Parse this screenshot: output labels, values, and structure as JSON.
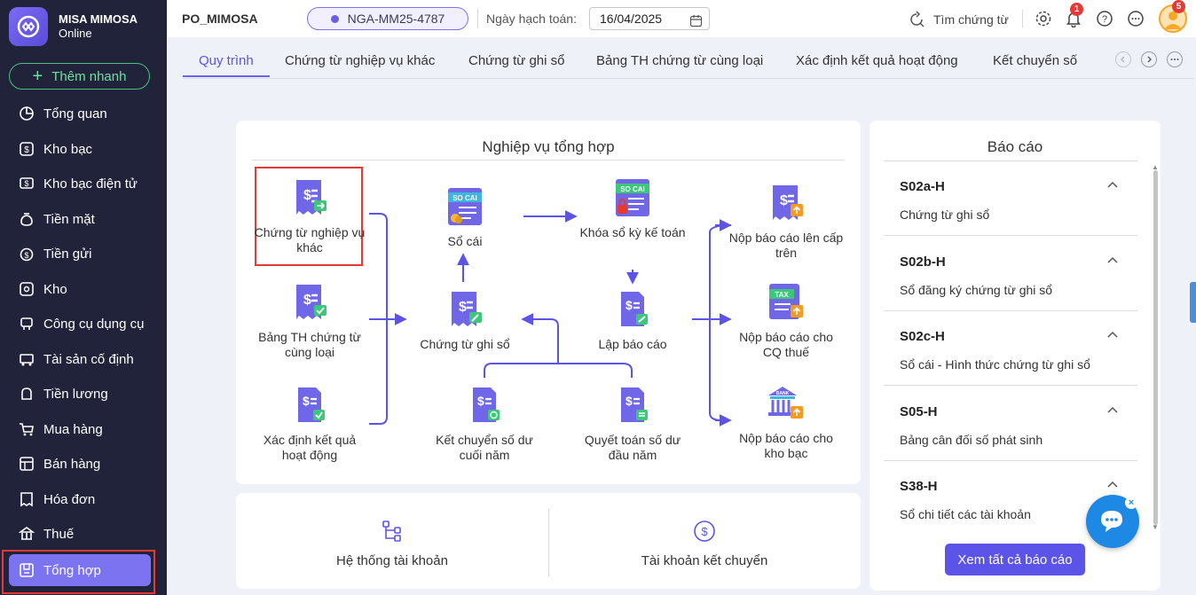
{
  "brand": {
    "name": "MISA MIMOSA",
    "sub": "Online"
  },
  "quick_add": {
    "label": "Thêm nhanh"
  },
  "sidebar": {
    "items": [
      {
        "label": "Tổng quan",
        "icon": "pie-chart-icon"
      },
      {
        "label": "Kho bạc",
        "icon": "treasury-icon"
      },
      {
        "label": "Kho bạc điện tử",
        "icon": "e-treasury-icon"
      },
      {
        "label": "Tiền mặt",
        "icon": "cash-icon"
      },
      {
        "label": "Tiền gửi",
        "icon": "deposit-icon"
      },
      {
        "label": "Kho",
        "icon": "warehouse-icon"
      },
      {
        "label": "Công cụ dụng cụ",
        "icon": "tools-icon"
      },
      {
        "label": "Tài sản cố định",
        "icon": "asset-icon"
      },
      {
        "label": "Tiền lương",
        "icon": "salary-icon"
      },
      {
        "label": "Mua hàng",
        "icon": "cart-icon"
      },
      {
        "label": "Bán hàng",
        "icon": "sales-icon"
      },
      {
        "label": "Hóa đơn",
        "icon": "invoice-icon"
      },
      {
        "label": "Thuế",
        "icon": "tax-icon"
      },
      {
        "label": "Tổng hợp",
        "icon": "summary-icon",
        "active": true
      }
    ]
  },
  "topbar": {
    "company": "PO_MIMOSA",
    "database": "NGA-MM25-4787",
    "date_label": "Ngày hạch toán:",
    "date_value": "16/04/2025",
    "search_label": "Tìm chứng từ",
    "notification_count": "1",
    "avatar_badge": "5"
  },
  "tabs": [
    {
      "label": "Quy trình",
      "active": true
    },
    {
      "label": "Chứng từ nghiệp vụ khác"
    },
    {
      "label": "Chứng từ ghi sổ"
    },
    {
      "label": "Bảng TH chứng từ cùng loại"
    },
    {
      "label": "Xác định kết quả hoạt động"
    },
    {
      "label": "Kết chuyển số"
    }
  ],
  "process": {
    "title": "Nghiệp vụ tổng hợp",
    "nodes": {
      "ct_nghiep_vu_khac": "Chứng từ nghiệp vụ khác",
      "bang_th": "Bảng TH chứng từ cùng loại",
      "xac_dinh_kq": "Xác định kết quả hoạt động",
      "so_cai": "Sổ cái",
      "ct_ghi_so": "Chứng từ ghi sổ",
      "ket_chuyen": "Kết chuyển số dư cuối năm",
      "khoa_so": "Khóa sổ kỳ kế toán",
      "lap_bao_cao": "Lập báo cáo",
      "quyet_toan": "Quyết toán số dư đầu năm",
      "nop_cap_tren": "Nộp báo cáo lên cấp trên",
      "nop_thue": "Nộp báo cáo cho CQ thuế",
      "nop_kho_bac": "Nộp báo cáo cho kho bạc"
    },
    "icon_labels": {
      "so_cai": "SO CAI",
      "tax": "TAX",
      "bank": "BANK"
    }
  },
  "bottom": {
    "he_thong_tk": "Hệ thống tài khoản",
    "tk_ket_chuyen": "Tài khoản kết chuyển"
  },
  "reports": {
    "title": "Báo cáo",
    "items": [
      {
        "code": "S02a-H",
        "name": "Chứng từ ghi sổ"
      },
      {
        "code": "S02b-H",
        "name": "Sổ đăng ký chứng từ ghi sổ"
      },
      {
        "code": "S02c-H",
        "name": "Sổ cái - Hình thức chứng từ ghi sổ"
      },
      {
        "code": "S05-H",
        "name": "Bảng cân đối số phát sinh"
      },
      {
        "code": "S38-H",
        "name": "Sổ chi tiết các tài khoản"
      }
    ],
    "view_all": "Xem tất cả báo cáo"
  },
  "colors": {
    "accent": "#5c54e8",
    "sidebar": "#20233a",
    "active_nav": "#7c73f0",
    "highlight": "#e53935"
  }
}
